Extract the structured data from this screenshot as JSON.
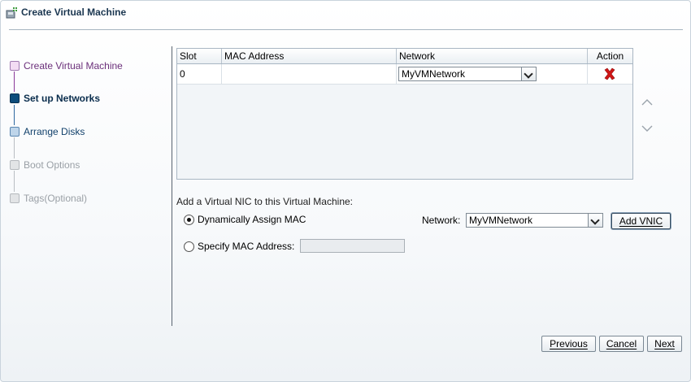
{
  "window": {
    "title": "Create Virtual Machine"
  },
  "steps": [
    {
      "label": "Create Virtual Machine",
      "state": "done"
    },
    {
      "label": "Set up Networks",
      "state": "current"
    },
    {
      "label": "Arrange Disks",
      "state": "active"
    },
    {
      "label": "Boot Options",
      "state": "disabled"
    },
    {
      "label": "Tags(Optional)",
      "state": "disabled"
    }
  ],
  "table": {
    "columns": [
      "Slot",
      "MAC Address",
      "Network",
      "Action"
    ],
    "rows": [
      {
        "slot": "0",
        "mac": "",
        "network": "MyVMNetwork",
        "action_icon": "delete-x-icon"
      }
    ]
  },
  "add_nic": {
    "caption": "Add a Virtual NIC to this Virtual Machine:",
    "dynamic_label": "Dynamically Assign MAC",
    "specify_label": "Specify MAC Address:",
    "mac_value": "",
    "network_label": "Network:",
    "network_value": "MyVMNetwork",
    "add_button": "Add VNIC"
  },
  "footer": {
    "previous": "Previous",
    "cancel": "Cancel",
    "next": "Next"
  },
  "colors": {
    "title": "#1a3650",
    "step_done": "#6b2f7a",
    "step_current": "#0a2d4d",
    "delete_icon": "#d01616"
  }
}
